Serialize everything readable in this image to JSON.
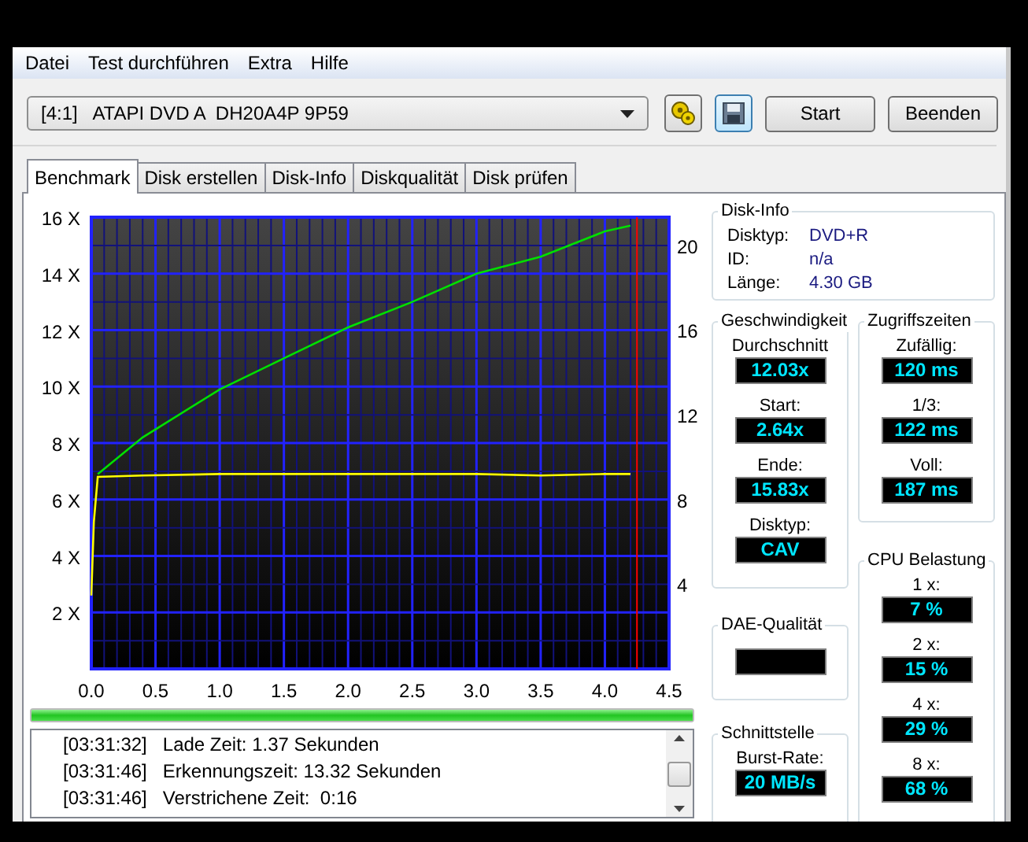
{
  "menu": [
    "Datei",
    "Test durchführen",
    "Extra",
    "Hilfe"
  ],
  "toolbar": {
    "drive": "[4:1]   ATAPI DVD A  DH20A4P 9P59",
    "buttons": [
      "Start",
      "Beenden"
    ]
  },
  "tabs": [
    {
      "label": "Benchmark",
      "selected": true
    },
    {
      "label": "Disk erstellen",
      "selected": false
    },
    {
      "label": "Disk-Info",
      "selected": false
    },
    {
      "label": "Diskqualität",
      "selected": false
    },
    {
      "label": "Disk prüfen",
      "selected": false
    }
  ],
  "chart_data": {
    "type": "line",
    "x": [
      0,
      0.02,
      0.05,
      0.4,
      1.0,
      1.5,
      2.0,
      2.5,
      3.0,
      3.5,
      4.0,
      4.2
    ],
    "series": [
      {
        "color": "#00e000",
        "values": [
          null,
          null,
          6.9,
          8.2,
          9.9,
          11.0,
          12.1,
          13.0,
          14.0,
          14.6,
          15.5,
          15.7
        ]
      },
      {
        "color": "#ffff00",
        "values": [
          2.6,
          5.2,
          6.8,
          6.85,
          6.9,
          6.9,
          6.9,
          6.9,
          6.9,
          6.85,
          6.9,
          6.9
        ]
      }
    ],
    "xlim": [
      0,
      4.5
    ],
    "ylim": [
      0,
      16
    ],
    "xticks": [
      {
        "value": 0,
        "label": "0.0"
      },
      {
        "value": 0.5,
        "label": "0.5"
      },
      {
        "value": 1,
        "label": "1.0"
      },
      {
        "value": 1.5,
        "label": "1.5"
      },
      {
        "value": 2,
        "label": "2.0"
      },
      {
        "value": 2.5,
        "label": "2.5"
      },
      {
        "value": 3,
        "label": "3.0"
      },
      {
        "value": 3.5,
        "label": "3.5"
      },
      {
        "value": 4,
        "label": "4.0"
      },
      {
        "value": 4.5,
        "label": "4.5"
      }
    ],
    "yticks": [
      {
        "value": 2,
        "label": "2 X"
      },
      {
        "value": 4,
        "label": "4 X"
      },
      {
        "value": 6,
        "label": "6 X"
      },
      {
        "value": 8,
        "label": "8 X"
      },
      {
        "value": 10,
        "label": "10 X"
      },
      {
        "value": 12,
        "label": "12 X"
      },
      {
        "value": 14,
        "label": "14 X"
      },
      {
        "value": 16,
        "label": "16 X"
      }
    ],
    "y2lim": [
      0,
      21.33
    ],
    "y2ticks": [
      4,
      8,
      12,
      16,
      20
    ],
    "grid": true,
    "ref_lines": [
      {
        "axis": "x",
        "value": 4.25,
        "color": "#ff0000"
      }
    ]
  },
  "progress": {
    "level": 1
  },
  "log": [
    {
      "time": "[03:31:32]",
      "message": "Lade Zeit: 1.37 Sekunden"
    },
    {
      "time": "[03:31:46]",
      "message": "Erkennungszeit: 13.32 Sekunden"
    },
    {
      "time": "[03:31:46]",
      "message": "Verstrichene Zeit:  0:16"
    }
  ],
  "disk_info": {
    "title": "Disk-Info",
    "rows": [
      {
        "label": "Disktyp:",
        "value": "DVD+R"
      },
      {
        "label": "ID:",
        "value": "n/a"
      },
      {
        "label": "Länge:",
        "value": "4.30 GB"
      }
    ]
  },
  "speed": {
    "title": "Geschwindigkeit",
    "readouts": [
      {
        "label": "Durchschnitt",
        "value": "12.03x"
      },
      {
        "label": "Start:",
        "value": "2.64x"
      },
      {
        "label": "Ende:",
        "value": "15.83x"
      },
      {
        "label": "Disktyp:",
        "value": "CAV"
      }
    ]
  },
  "dae_quality": {
    "title": "DAE-Qualität"
  },
  "interface": {
    "title": "Schnittstelle",
    "readouts": [
      {
        "label": "Burst-Rate:",
        "value": "20 MB/s"
      }
    ]
  },
  "access_times": {
    "title": "Zugriffszeiten",
    "readouts": [
      {
        "label": "Zufällig:",
        "value": "120 ms"
      },
      {
        "label": "1/3:",
        "value": "122 ms"
      },
      {
        "label": "Voll:",
        "value": "187 ms"
      }
    ]
  },
  "cpu_load": {
    "title": "CPU Belastung",
    "readouts": [
      {
        "label": "1 x:",
        "value": "7 %"
      },
      {
        "label": "2 x:",
        "value": "15 %"
      },
      {
        "label": "4 x:",
        "value": "29 %"
      },
      {
        "label": "8 x:",
        "value": "68 %"
      }
    ]
  }
}
